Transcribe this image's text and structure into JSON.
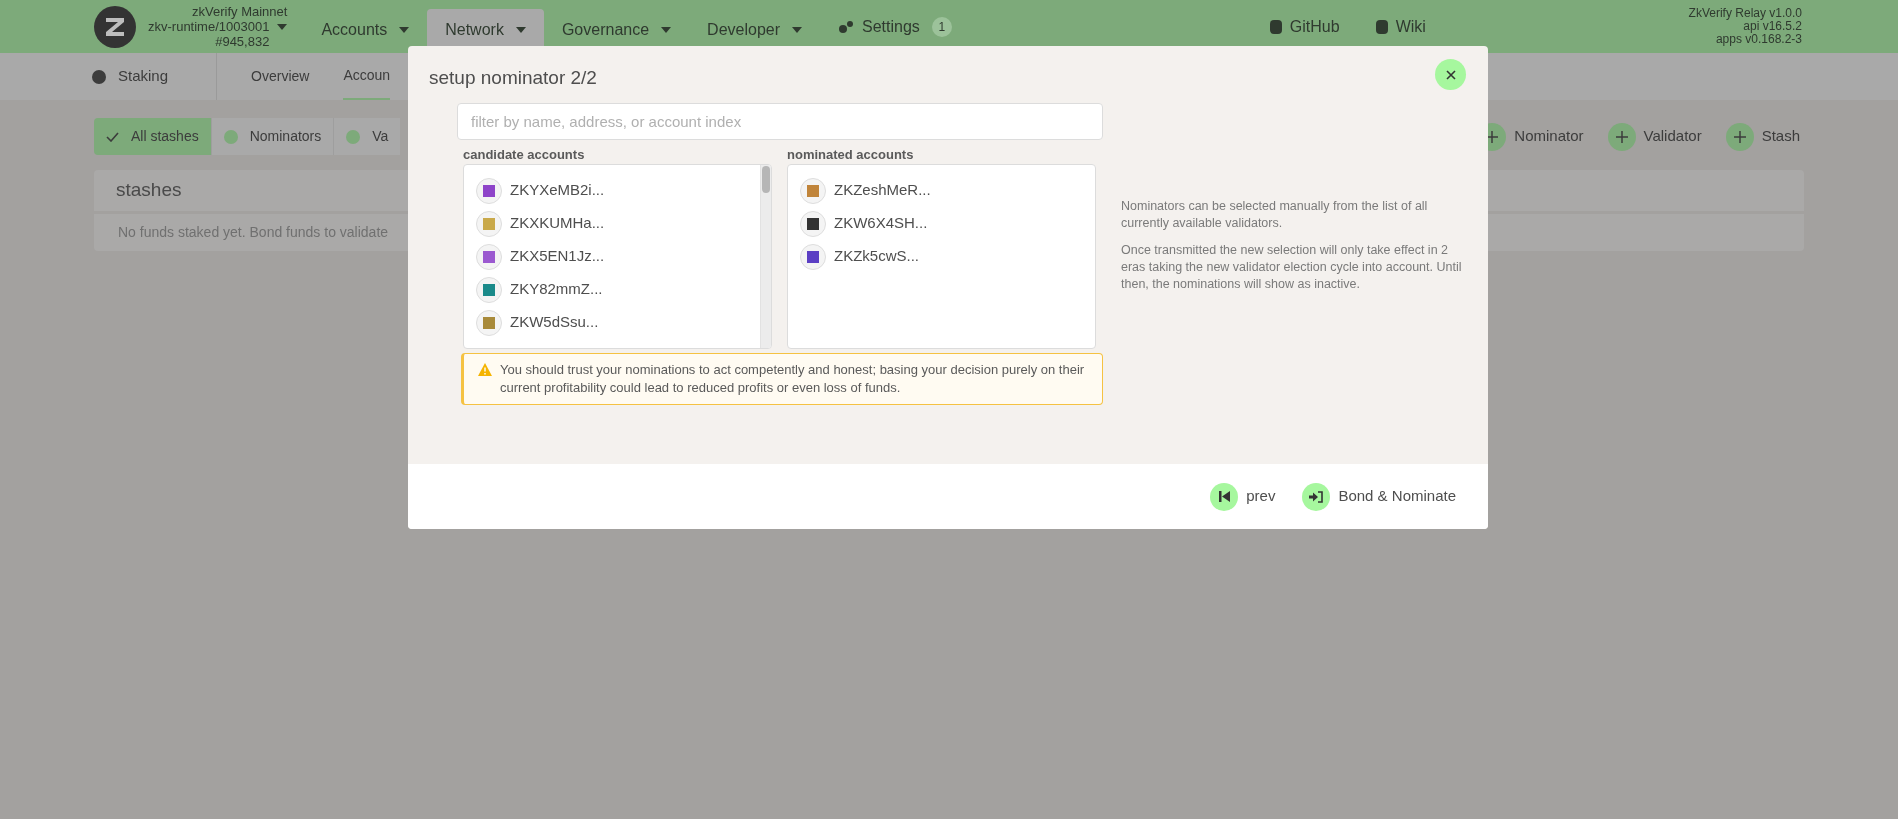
{
  "header": {
    "chain": "zkVerify Mainnet",
    "runtime": "zkv-runtime/1003001",
    "block": "#945,832",
    "menu": [
      {
        "label": "Accounts",
        "selected": false
      },
      {
        "label": "Network",
        "selected": true
      },
      {
        "label": "Governance",
        "selected": false
      },
      {
        "label": "Developer",
        "selected": false
      }
    ],
    "settings": {
      "label": "Settings",
      "badge": "1"
    },
    "links": [
      "GitHub",
      "Wiki"
    ],
    "versions": [
      "ZkVerify Relay v1.0.0",
      "api v16.5.2",
      "apps v0.168.2-3"
    ]
  },
  "subnav": {
    "section": "Staking",
    "tabs": [
      {
        "label": "Overview",
        "selected": false
      },
      {
        "label": "Accoun",
        "selected": true
      }
    ]
  },
  "filters": [
    {
      "label": "All stashes",
      "selected": true
    },
    {
      "label": "Nominators",
      "selected": false
    },
    {
      "label": "Va",
      "selected": false
    }
  ],
  "actions": [
    "Nominator",
    "Validator",
    "Stash"
  ],
  "stashes": {
    "title": "stashes",
    "empty": "No funds staked yet. Bond funds to validate"
  },
  "modal": {
    "title": "setup nominator 2/2",
    "filter": {
      "placeholder": "filter by name, address, or account index"
    },
    "candidate_label": "candidate accounts",
    "candidates": [
      {
        "name": "ZKYXeMB2i...",
        "color": "#8e44c9"
      },
      {
        "name": "ZKXKUMHa...",
        "color": "#c9a94a"
      },
      {
        "name": "ZKX5EN1Jz...",
        "color": "#9b59d0"
      },
      {
        "name": "ZKY82mmZ...",
        "color": "#1a8a8a"
      },
      {
        "name": "ZKW5dSsu...",
        "color": "#a88a3a"
      }
    ],
    "nominated_label": "nominated accounts",
    "nominated": [
      {
        "name": "ZKZeshMeR...",
        "color": "#c0843a"
      },
      {
        "name": "ZKW6X4SH...",
        "color": "#333333"
      },
      {
        "name": "ZKZk5cwS...",
        "color": "#5b3fc4"
      }
    ],
    "warning": "You should trust your nominations to act competently and honest; basing your decision purely on their current profitability could lead to reduced profits or even loss of funds.",
    "help": [
      "Nominators can be selected manually from the list of all currently available validators.",
      "Once transmitted the new selection will only take effect in 2 eras taking the new validator election cycle into account. Until then, the nominations will show as inactive."
    ],
    "buttons": [
      {
        "kind": "prev",
        "label": "prev"
      },
      {
        "kind": "submit",
        "label": "Bond & Nominate"
      }
    ]
  }
}
